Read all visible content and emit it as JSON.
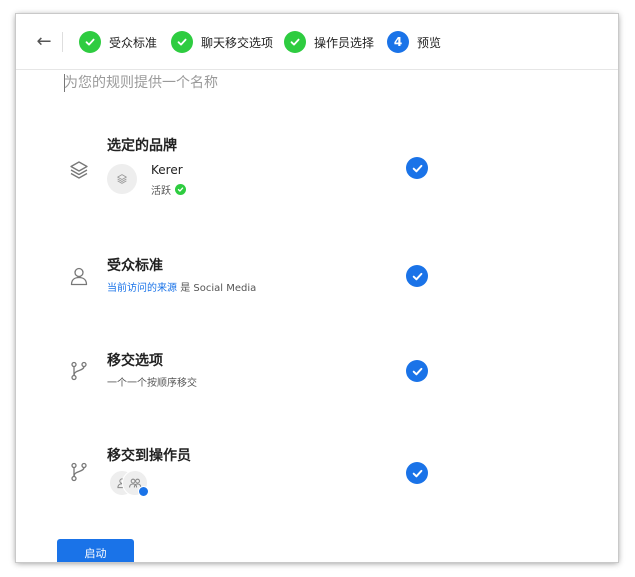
{
  "header": {
    "back_icon": "arrow-left-icon",
    "steps": [
      {
        "number": "",
        "label": "受众标准",
        "status": "done"
      },
      {
        "number": "",
        "label": "聊天移交选项",
        "status": "done"
      },
      {
        "number": "",
        "label": "操作员选择",
        "status": "done"
      },
      {
        "number": "4",
        "label": "预览",
        "status": "active"
      }
    ]
  },
  "rule_name": {
    "value": "",
    "placeholder": "为您的规则提供一个名称"
  },
  "sections": {
    "brand": {
      "title": "选定的品牌",
      "icon": "layers-icon",
      "brand_name": "Kerer",
      "status": "活跃"
    },
    "audience": {
      "title": "受众标准",
      "icon": "user-icon",
      "condition_link": "当前访问的来源",
      "condition_op": "是",
      "condition_value": "Social Media"
    },
    "handoff": {
      "title": "移交选项",
      "icon": "branch-icon",
      "description": "一个一个按顺序移交"
    },
    "operators": {
      "title": "移交到操作员",
      "icon": "branch-icon"
    }
  },
  "footer": {
    "launch_label": "启动"
  },
  "colors": {
    "primary": "#1a73e8",
    "success": "#2ecc40"
  }
}
